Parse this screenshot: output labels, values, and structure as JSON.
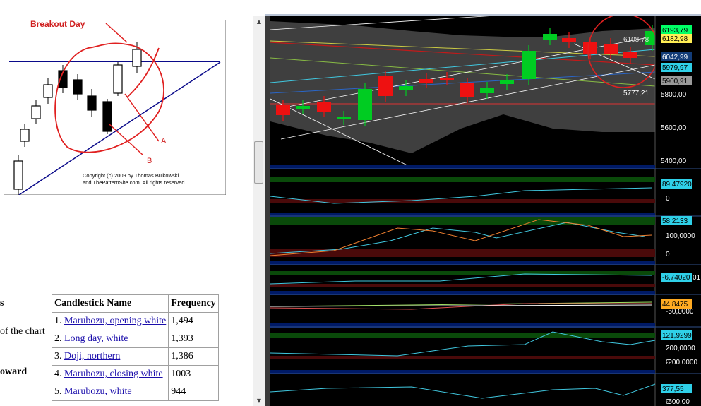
{
  "figure": {
    "title": "Breakout Day",
    "label_a": "A",
    "label_b": "B",
    "copyright_line1": "Copyright (c) 2009 by Thomas Bulkowski",
    "copyright_line2": "and ThePatternSite.com. All rights reserved."
  },
  "page_text": {
    "cut_s": "s",
    "cut_chart": "of the chart",
    "cut_oward": "oward"
  },
  "table": {
    "headers": [
      "Candlestick Name",
      "Frequency"
    ],
    "rows": [
      {
        "num": "1.",
        "name": "Marubozu, opening white",
        "freq": "1,494"
      },
      {
        "num": "2.",
        "name": "Long day, white",
        "freq": "1,393"
      },
      {
        "num": "3.",
        "name": "Doji, northern",
        "freq": "1,386"
      },
      {
        "num": "4.",
        "name": "Marubozu, closing white",
        "freq": "1003"
      },
      {
        "num": "5.",
        "name": "Marubozu, white",
        "freq": "944"
      }
    ]
  },
  "price_panel": {
    "axis": [
      "5800,00",
      "5600,00",
      "5400,00"
    ],
    "badges": [
      {
        "text": "6193,79",
        "bg": "#00ff66",
        "fg": "#000000"
      },
      {
        "text": "6182,98",
        "bg": "#ffee55",
        "fg": "#000000"
      },
      {
        "text": "6042,99",
        "bg": "#123c78",
        "fg": "#ffffff"
      },
      {
        "text": "5979,97",
        "bg": "#2fd0e8",
        "fg": "#000000"
      },
      {
        "text": "5900,91",
        "bg": "#9a9a9a",
        "fg": "#000000"
      }
    ],
    "annotations": [
      "6108,78",
      "5777,21"
    ]
  },
  "indicator_panels": [
    {
      "axis": [
        "0"
      ],
      "badge": "89,47920",
      "badge_color": "#2fd0e8"
    },
    {
      "axis": [
        "100,0000",
        "0"
      ],
      "badge": "58,2133",
      "badge_color": "#2fd0e8"
    },
    {
      "axis": [],
      "badge": "-6,74020",
      "badge_color": "#2fd0e8",
      "suffix": "01"
    },
    {
      "axis": [
        "-50,0000"
      ],
      "badge": "44,8475",
      "badge_color": "#ffaa22"
    },
    {
      "axis": [
        "200,0000",
        "0",
        "-200,0000"
      ],
      "badge": "121,9299",
      "badge_color": "#2fd0e8"
    },
    {
      "axis": [
        "0",
        "-500,00"
      ],
      "badge": "377,55",
      "badge_color": "#2fd0e8"
    }
  ],
  "colors": {
    "chart_bg": "#000000",
    "panel_sep": "#001a66",
    "bull": "#00cc22",
    "bear": "#ee1111",
    "annotation": "#e02020"
  }
}
